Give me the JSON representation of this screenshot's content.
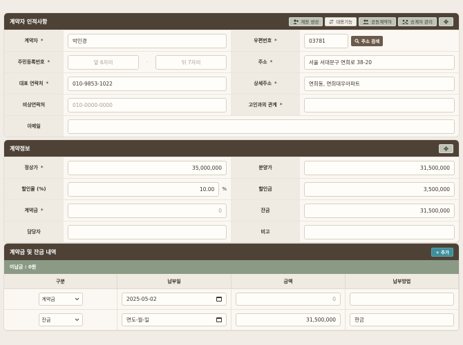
{
  "contractor": {
    "title": "계약자 인적사항",
    "buttons": {
      "add_contract": "계정 생성",
      "toggle": "대용기능",
      "co_contractor": "공동계약자",
      "successor": "승계자 관리"
    },
    "labels": {
      "name": "계약자",
      "postal": "우편번호",
      "resident_no": "주민등록번호",
      "address": "주소",
      "phone": "대표 연락처",
      "address_detail": "상세주소",
      "emergency": "비상연락처",
      "relation": "고인과의 관계",
      "email": "이메일"
    },
    "values": {
      "name": "박인경",
      "postal": "03781",
      "resident_front_placeholder": "앞 6자리",
      "resident_back_placeholder": "뒤 7자리",
      "address": "서울 서대문구 연희로 38-20",
      "phone": "010-9853-1022",
      "address_detail": "연희동, 연희대우아파트",
      "emergency_placeholder": "010-0000-0000",
      "relation": "",
      "email": ""
    },
    "search_button": "주소 검색",
    "required_mark": "*",
    "dash": "-"
  },
  "contract": {
    "title": "계약정보",
    "labels": {
      "list_price": "정상가",
      "sale_price": "분양가",
      "discount_rate": "할인율 (%)",
      "discount_amount": "할인금",
      "deposit": "계약금",
      "balance": "잔금",
      "manager": "담당자",
      "note": "비고"
    },
    "values": {
      "list_price": "35,000,000",
      "sale_price": "31,500,000",
      "discount_rate": "10.00",
      "discount_unit": "%",
      "discount_amount": "3,500,000",
      "deposit": "0",
      "balance": "31,500,000",
      "manager": "",
      "note": ""
    }
  },
  "payments": {
    "title": "계약금 및 잔금 내역",
    "add_button": "+ 추가",
    "unpaid": "미납금 : 0원",
    "columns": [
      "구분",
      "납부일",
      "금액",
      "납부방법"
    ],
    "rows": [
      {
        "type": "계약금",
        "date": "2025-05-02",
        "amount": "0",
        "method": ""
      },
      {
        "type": "잔금",
        "date": "연도-월-일",
        "amount": "31,500,000",
        "method": "현금"
      }
    ]
  },
  "colors": {
    "header": "#4e4237",
    "subbar": "#8a9a85",
    "accent": "#3e8f9a"
  }
}
